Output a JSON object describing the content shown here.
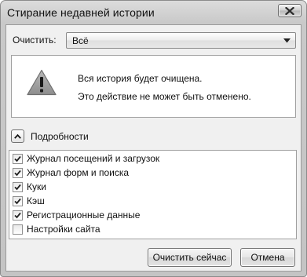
{
  "window": {
    "title": "Стирание недавней истории"
  },
  "icons": {
    "close": "close-icon",
    "dropdown": "chevron-down-icon",
    "warning": "warning-triangle-icon",
    "details_toggle": "chevron-up-icon",
    "checkmark": "checkmark-icon"
  },
  "clear": {
    "label": "Очистить:",
    "selected": "Всё"
  },
  "warning": {
    "line1": "Вся история будет очищена.",
    "line2": "Это действие не может быть отменено."
  },
  "details": {
    "label": "Подробности",
    "expanded": true
  },
  "items": [
    {
      "label": "Журнал посещений и загрузок",
      "checked": true
    },
    {
      "label": "Журнал форм и поиска",
      "checked": true
    },
    {
      "label": "Куки",
      "checked": true
    },
    {
      "label": "Кэш",
      "checked": true
    },
    {
      "label": "Регистрационные данные",
      "checked": true
    },
    {
      "label": "Настройки сайта",
      "checked": false
    }
  ],
  "buttons": {
    "clear_now": "Очистить сейчас",
    "cancel": "Отмена"
  }
}
